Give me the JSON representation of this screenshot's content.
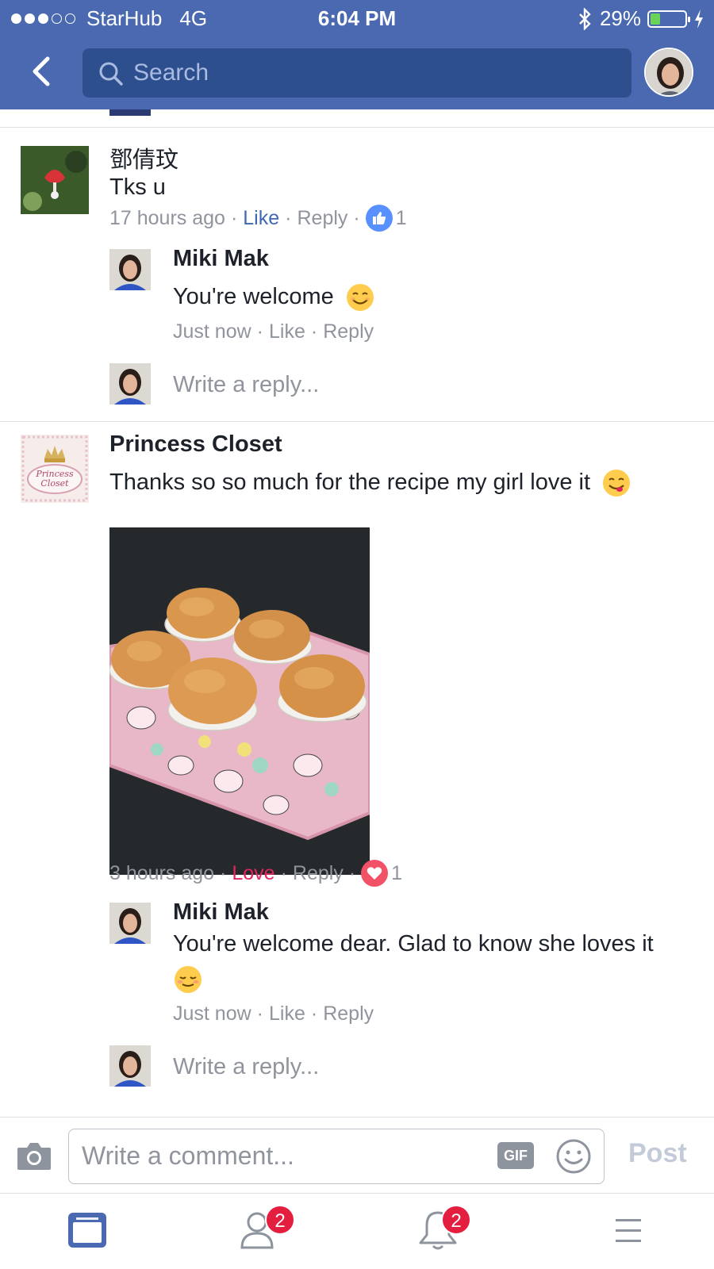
{
  "status_bar": {
    "carrier": "StarHub",
    "network": "4G",
    "time": "6:04 PM",
    "battery": "29%",
    "battery_level": 0.29
  },
  "header": {
    "search_placeholder": "Search"
  },
  "thread": {
    "comment1": {
      "author": "鄧倩玟",
      "text": "Tks u",
      "time": "17 hours ago",
      "like_label": "Like",
      "reply_label": "Reply",
      "reaction_count": "1"
    },
    "reply1": {
      "author": "Miki Mak",
      "text": "You're welcome",
      "time": "Just now",
      "like_label": "Like",
      "reply_label": "Reply"
    },
    "write_reply_1": "Write a reply...",
    "comment2": {
      "author": "Princess Closet",
      "text": "Thanks so so much for the recipe my girl love it",
      "logo_text": "Princess Closet",
      "time": "3 hours ago",
      "love_label": "Love",
      "reply_label": "Reply",
      "reaction_count": "1"
    },
    "reply2": {
      "author": "Miki Mak",
      "text": "You're welcome dear. Glad to know she loves it",
      "time": "Just now",
      "like_label": "Like",
      "reply_label": "Reply"
    },
    "write_reply_2": "Write a reply..."
  },
  "composer": {
    "placeholder": "Write a comment...",
    "gif_label": "GIF",
    "post_label": "Post"
  },
  "tabbar": {
    "friends_badge": "2",
    "notifications_badge": "2"
  },
  "colors": {
    "header_blue": "#4a69b0",
    "search_blue": "#2e4f8e",
    "like_blue": "#4267b2",
    "love_red": "#e0245e",
    "badge_red": "#e41e3f"
  }
}
